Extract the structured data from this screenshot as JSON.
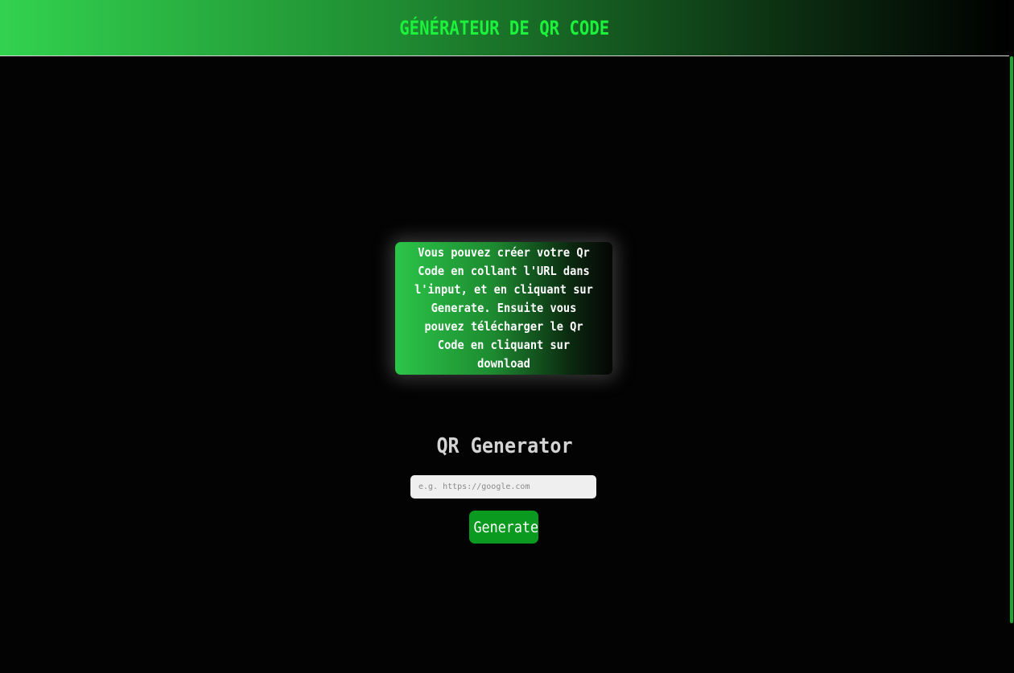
{
  "header": {
    "title": "GÉNÉRATEUR DE QR CODE"
  },
  "info_card": {
    "text": "Vous pouvez créer votre Qr Code en collant l'URL dans l'input, et en cliquant sur Generate. Ensuite vous pouvez télécharger le Qr Code en cliquant sur download"
  },
  "generator": {
    "title": "QR Generator",
    "input_placeholder": "e.g. https://google.com",
    "input_value": "",
    "button_label": "Generate"
  },
  "colors": {
    "accent_green": "#1cf23c",
    "button_green": "#0a9a1f",
    "background": "#030303"
  }
}
